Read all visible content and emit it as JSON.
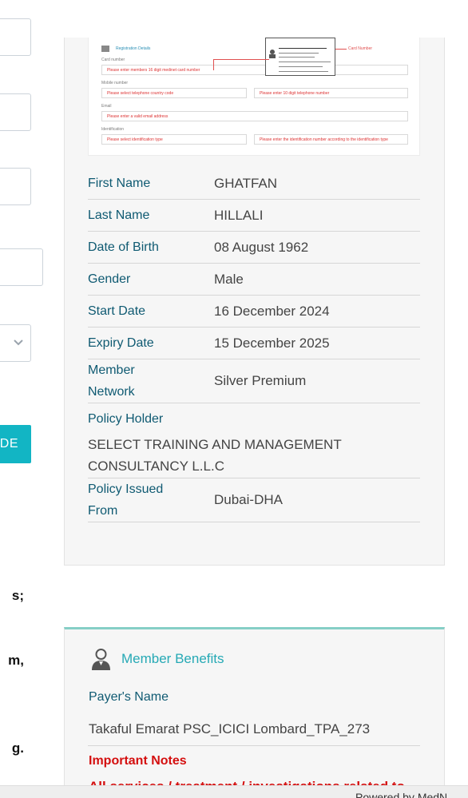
{
  "left_column": {
    "button_label": "DE",
    "text_lines": [
      "s;",
      "m,",
      "g."
    ]
  },
  "registration_mock": {
    "section_title": "Registration Details",
    "card_number_label": "Card number",
    "card_number_placeholder": "Please enter members 16 digit medinet card number",
    "mobile_label": "Mobile number",
    "country_code_placeholder": "Please select telephone country code",
    "mobile_placeholder": "Please enter 10 digit telephone number",
    "email_label": "Email",
    "email_placeholder": "Please enter a valid email address",
    "identification_label": "Identification",
    "id_type_placeholder": "Please select identification type",
    "id_number_placeholder": "Please enter the identification number according to the identification type",
    "card_annotation": "Card Number"
  },
  "member": {
    "rows": [
      {
        "label": "First Name",
        "value": "GHATFAN"
      },
      {
        "label": "Last Name",
        "value": "HILLALI"
      },
      {
        "label": "Date of Birth",
        "value": "08 August 1962"
      },
      {
        "label": "Gender",
        "value": "Male"
      },
      {
        "label": "Start Date",
        "value": "16 December 2024"
      },
      {
        "label": "Expiry Date",
        "value": "15 December 2025"
      },
      {
        "label": "Member Network",
        "value": "Silver Premium"
      },
      {
        "label": "Policy Holder",
        "value": "SELECT TRAINING AND MANAGEMENT CONSULTANCY L.L.C"
      },
      {
        "label": "Policy Issued From",
        "value": "Dubai-DHA"
      }
    ]
  },
  "benefits": {
    "title": "Member Benefits",
    "payer_label": "Payer's Name",
    "payer_value": "Takaful Emarat PSC_ICICI Lombard_TPA_273",
    "notes_title": "Important Notes",
    "notes_text": "All services / treatment / investigations related to"
  },
  "footer": {
    "text": "Powered by MedN"
  },
  "colors": {
    "accent": "#12b5c4",
    "label": "#0f5a72",
    "important": "#d40f0f",
    "benefits_border": "#86cfc6"
  }
}
